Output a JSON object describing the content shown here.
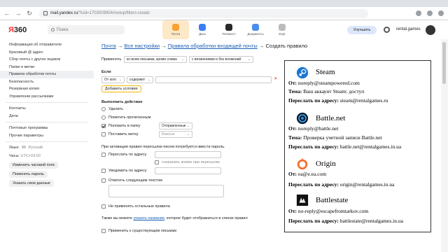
{
  "browser": {
    "url_host": "mail.yandex.ru",
    "url_path": "/?uid=1703009904#setup/filters-create"
  },
  "header": {
    "logo_y": "Я",
    "logo_rest": "360",
    "search_placeholder": "Поиск",
    "apps": [
      {
        "label": "Почта",
        "color": "#f7a233",
        "active": true
      },
      {
        "label": "Диск",
        "color": "#3d7ef5",
        "active": false
      },
      {
        "label": "Телемост",
        "color": "#2a2a2a",
        "active": false
      },
      {
        "label": "Документы",
        "color": "#4a8cf0",
        "active": false
      },
      {
        "label": "Ещё",
        "color": "#bbbbbb",
        "active": false
      }
    ],
    "upgrade_label": "Улучшить",
    "account_name": "rental.games"
  },
  "sidebar": {
    "items": [
      {
        "label": "Информация об отправителе",
        "active": false
      },
      {
        "label": "Красивый @ адрес",
        "active": false
      },
      {
        "label": "Сбор почты с других ящиков",
        "active": false
      },
      {
        "label": "Папки и метки",
        "active": false
      },
      {
        "label": "Правила обработки почты",
        "active": true
      },
      {
        "label": "Безопасность",
        "active": false
      },
      {
        "label": "Резервная копия",
        "active": false
      },
      {
        "label": "Управление рассылками",
        "active": false
      }
    ],
    "items2": [
      {
        "label": "Контакты"
      },
      {
        "label": "Дела"
      }
    ],
    "items3": [
      {
        "label": "Почтовые программы"
      },
      {
        "label": "Прочие параметры"
      }
    ],
    "language_label": "Язык:",
    "language_value": "Русский",
    "timezone_label": "Часы:",
    "timezone_value": "UTC+03:00",
    "buttons": [
      "Изменить часовой пояс",
      "Поменять пароль",
      "Указать свои данные"
    ]
  },
  "form": {
    "breadcrumb": {
      "mail": "Почта",
      "arrow": " → ",
      "all_settings": "Все настройки",
      "rules": "Правила обработки входящей почты",
      "current": "Создать правило"
    },
    "apply_label": "Применять",
    "apply_select1": "ко всем письмам, кроме спама",
    "apply_select2": "с вложениями и без вложений",
    "if_heading": "Если",
    "cond_field": "От кого",
    "cond_op": "содержит",
    "add_condition": "Добавить условие",
    "action_heading": "Выполнить действие",
    "actions": [
      {
        "label": "Удалить",
        "checked": false
      },
      {
        "label": "Пометить прочитанным",
        "checked": false
      },
      {
        "label": "Положить в папку",
        "checked": true,
        "select": "Отправленные"
      },
      {
        "label": "Поставить метку",
        "checked": false,
        "select": "Важные"
      }
    ],
    "password_note": "При активации правил пересылки писем потребуется ввести пароль.",
    "forward_label": "Переслать по адресу",
    "keep_copy": "сохранить копию при пересылке",
    "notify_label": "Уведомить по адресу",
    "reply_label": "Ответить следующим текстом",
    "dont_apply": "Не применять остальные правила",
    "name_note_pre": "Также вы можете ",
    "name_note_link": "указать название",
    "name_note_post": ", которое будет отображаться в списке правил",
    "apply_existing": "Применить к существующим письмам"
  },
  "panel": {
    "services": [
      {
        "name": "Steam",
        "logo": "steam-logo",
        "from_label": "От:",
        "from_value": "noreply@steampowered.com",
        "subject_label": "Тема:",
        "subject_value": "Ваш аккаунт Steam: доступ",
        "forward_label": "Переслать по адресу:",
        "forward_value": "steam@rentalgames.ru"
      },
      {
        "name": "Battle.net",
        "logo": "battlenet-logo",
        "from_label": "От:",
        "from_value": "noreply@battle.net",
        "subject_label": "Тема:",
        "subject_value": "Проверка учетной записи Battle.net",
        "forward_label": "Переслать по адресу:",
        "forward_value": "battle.net@rentalgames.in.ua"
      },
      {
        "name": "Origin",
        "logo": "origin-logo",
        "from_label": "От:",
        "from_value": "ea@e.ea.com",
        "subject_label": "",
        "subject_value": "",
        "forward_label": "Переслать по адресу:",
        "forward_value": "origin@rentalgames.in.ua"
      },
      {
        "name": "Battlestate",
        "logo": "battlestate-logo",
        "from_label": "От:",
        "from_value": "no-reply@escapefromtarkov.com",
        "subject_label": "",
        "subject_value": "",
        "forward_label": "Переслать по адресу:",
        "forward_value": "battlestate@rentalgames.in.ua"
      }
    ]
  },
  "colors": {
    "accent_link": "#1a5fb4",
    "active_app": "#fde8c8",
    "add_condition_border": "#f5b700"
  }
}
